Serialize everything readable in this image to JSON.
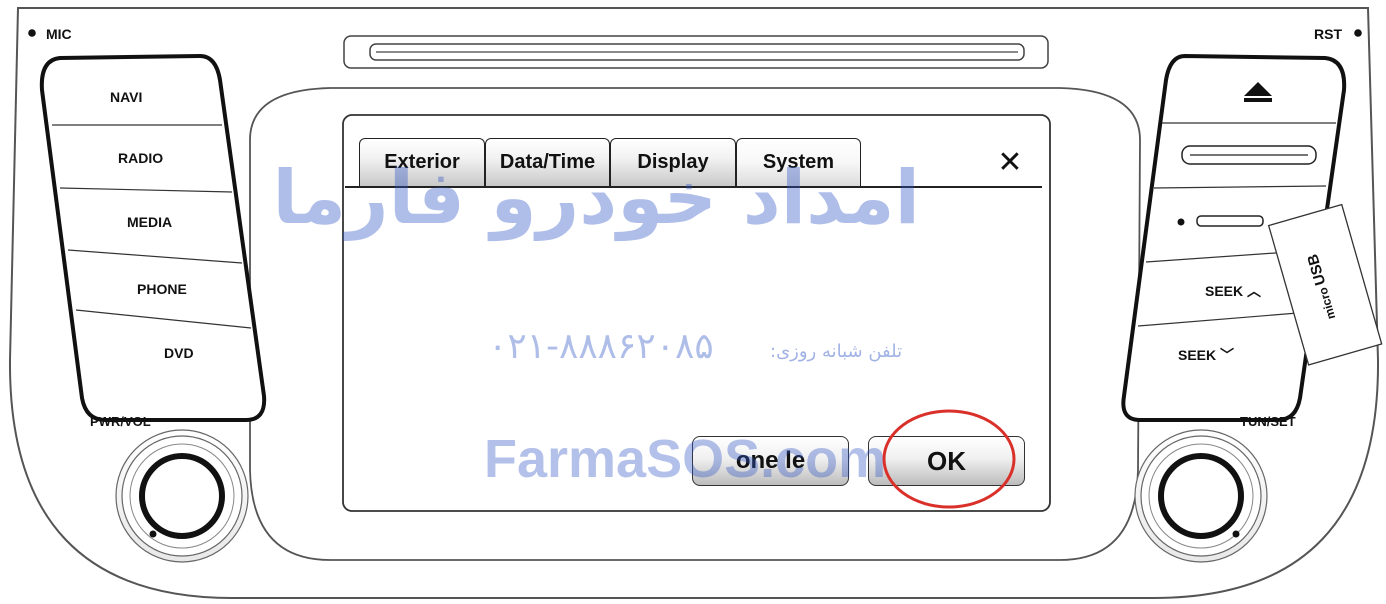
{
  "panel": {
    "mic_label": "MIC",
    "rst_label": "RST",
    "pwr_vol_label": "PWR/VOL",
    "tun_set_label": "TUN/SET",
    "usb_label_micro": "micro",
    "usb_label_usb": "USB"
  },
  "left_buttons": [
    {
      "label": "NAVI"
    },
    {
      "label": "RADIO"
    },
    {
      "label": "MEDIA"
    },
    {
      "label": "PHONE"
    },
    {
      "label": "DVD"
    }
  ],
  "right_buttons": {
    "seek_up": "SEEK ︿",
    "seek_down": "SEEK ﹀"
  },
  "dialog": {
    "tabs": [
      {
        "label": "Exterior"
      },
      {
        "label": "Data/Time"
      },
      {
        "label": "Display"
      },
      {
        "label": "System"
      }
    ],
    "active_tab": "System",
    "close_glyph": "✕",
    "cancel_label": "one le",
    "ok_label": "OK"
  },
  "watermark": {
    "persian_name": "امداد خودرو فارما",
    "phone_label": "تلفن شبانه روزی:",
    "phone_number": "۰۲۱-۸۸۸۶۲۰۸۵",
    "site": "FarmaSOS.com"
  },
  "colors": {
    "highlight_circle": "#d9302a",
    "watermark": "#2f56c6"
  }
}
